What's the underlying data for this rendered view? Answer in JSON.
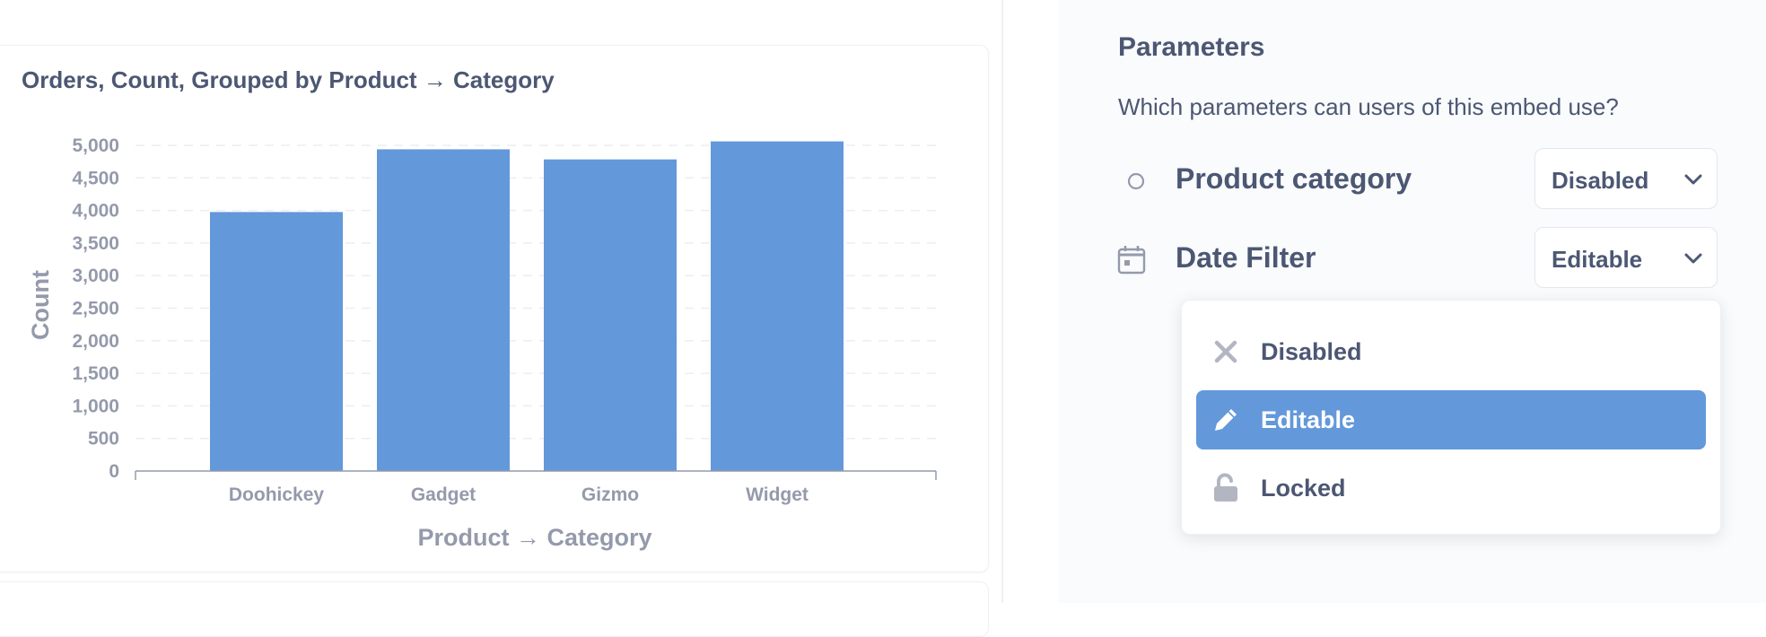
{
  "card": {
    "title": "Orders, Count, Grouped by Product → Category"
  },
  "chart_data": {
    "type": "bar",
    "title": "Orders, Count, Grouped by Product → Category",
    "xlabel": "Product → Category",
    "ylabel": "Count",
    "categories": [
      "Doohickey",
      "Gadget",
      "Gizmo",
      "Widget"
    ],
    "values": [
      3976,
      4939,
      4784,
      5061
    ],
    "ylim": [
      0,
      5000
    ],
    "yticks": [
      "0",
      "500",
      "1,000",
      "1,500",
      "2,000",
      "2,500",
      "3,000",
      "3,500",
      "4,000",
      "4,500",
      "5,000"
    ],
    "grid": true,
    "bar_color": "#6398db"
  },
  "parameters": {
    "title": "Parameters",
    "description": "Which parameters can users of this embed use?",
    "items": [
      {
        "label": "Product category",
        "value": "Disabled",
        "icon": "circle-outline-icon"
      },
      {
        "label": "Date Filter",
        "value": "Editable",
        "icon": "calendar-icon"
      }
    ]
  },
  "dropdown": {
    "options": [
      {
        "label": "Disabled",
        "icon": "close-icon",
        "selected": false
      },
      {
        "label": "Editable",
        "icon": "pencil-icon",
        "selected": true
      },
      {
        "label": "Locked",
        "icon": "lock-icon",
        "selected": false
      }
    ]
  },
  "colors": {
    "accent": "#6398db",
    "text": "#4c5773",
    "muted": "#949aab"
  }
}
